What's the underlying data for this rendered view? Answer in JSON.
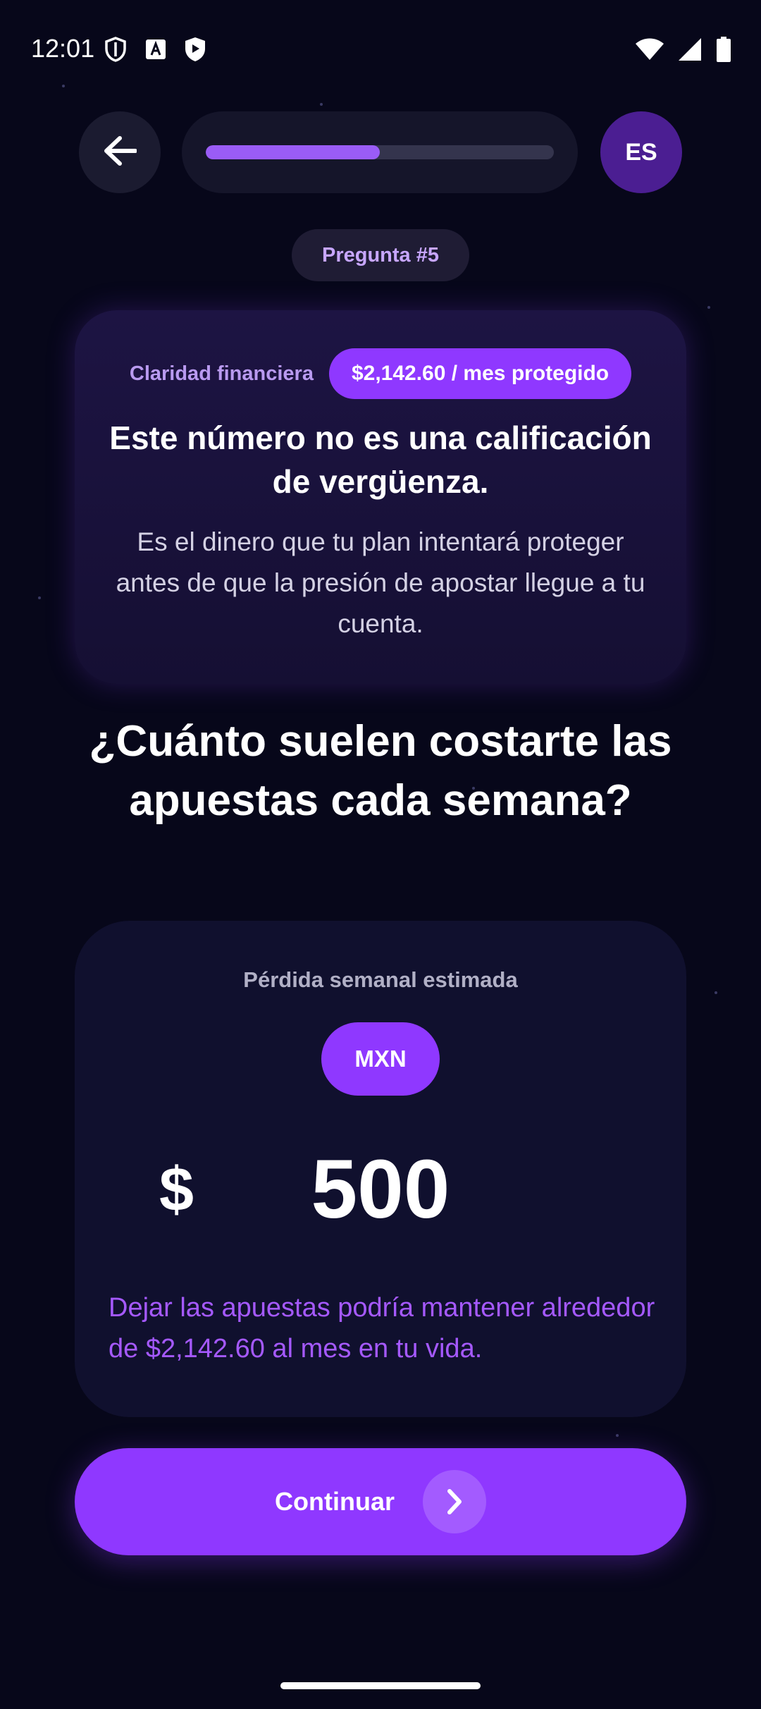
{
  "status_bar": {
    "time": "12:01",
    "left_icons": [
      "shield-outline-icon",
      "a-box-icon",
      "play-shield-icon"
    ],
    "right_icons": [
      "wifi-icon",
      "signal-icon",
      "battery-icon"
    ]
  },
  "nav": {
    "back_icon": "arrow-left-icon",
    "progress_fraction": 0.5,
    "language_label": "ES"
  },
  "question_label": "Pregunta #5",
  "info_card": {
    "category": "Claridad financiera",
    "badge": "$2,142.60 / mes protegido",
    "title": "Este número no es una calificación de vergüenza.",
    "text": "Es el dinero que tu plan intentará proteger antes de que la presión de apostar llegue a tu cuenta."
  },
  "main_question": "¿Cuánto suelen costarte las apuestas cada semana?",
  "estimate": {
    "label": "Pérdida semanal estimada",
    "currency": "MXN",
    "symbol": "$",
    "amount": "500",
    "note": "Dejar las apuestas podría mantener alrededor de $2,142.60 al mes en tu vida."
  },
  "continue": {
    "label": "Continuar",
    "icon": "chevron-right-icon"
  },
  "colors": {
    "background": "#07071a",
    "accent": "#8f38ff",
    "accent_text": "#a559ff"
  }
}
